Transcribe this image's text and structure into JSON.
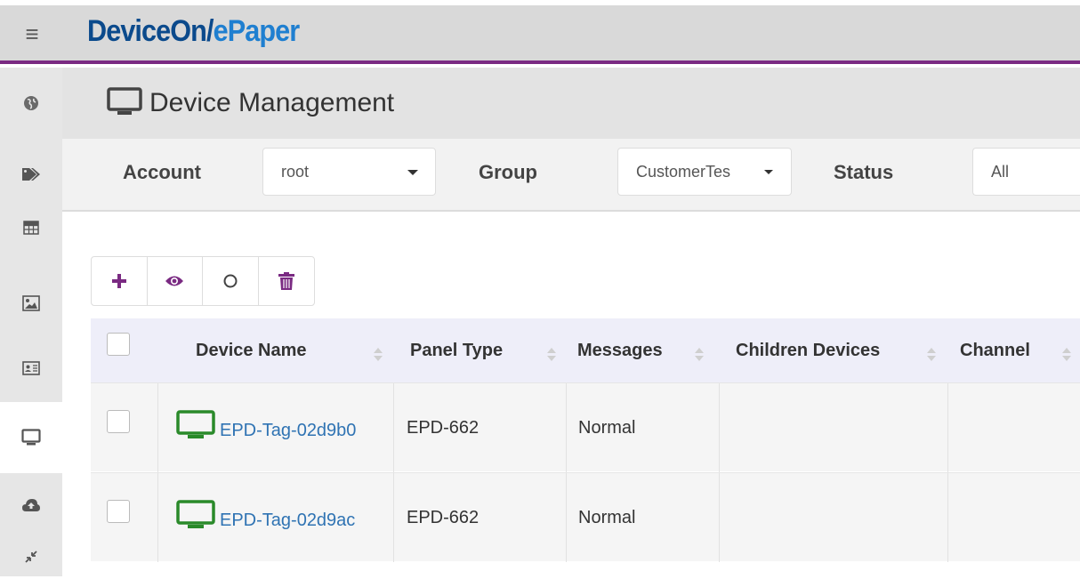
{
  "app": {
    "logo_part1": "DeviceOn/",
    "logo_part2": "ePaper",
    "brand_color": "#0b4a8c",
    "accent_color": "#7a2a82"
  },
  "sidebar": {
    "items": [
      {
        "icon": "globe-icon"
      },
      {
        "icon": "tags-icon"
      },
      {
        "icon": "table-icon"
      },
      {
        "icon": "image-icon"
      },
      {
        "icon": "id-card-icon"
      },
      {
        "icon": "monitor-icon",
        "active": true
      },
      {
        "icon": "cloud-upload-icon"
      },
      {
        "icon": "compress-icon"
      }
    ]
  },
  "page": {
    "title": "Device Management",
    "title_icon": "monitor-icon"
  },
  "filters": {
    "account_label": "Account",
    "account_value": "root",
    "group_label": "Group",
    "group_value": "CustomerTes",
    "status_label": "Status",
    "status_value": "All"
  },
  "toolbar": {
    "add_icon": "plus-icon",
    "view_icon": "eye-icon",
    "status_icon": "circle-icon",
    "delete_icon": "trash-icon",
    "add_color": "#7a2a82"
  },
  "table": {
    "columns": [
      "Device Name",
      "Panel Type",
      "Messages",
      "Children Devices",
      "Channel"
    ],
    "rows": [
      {
        "name": "EPD-Tag-02d9b0",
        "panel_type": "EPD-662",
        "messages": "Normal",
        "children": "",
        "channel": ""
      },
      {
        "name": "EPD-Tag-02d9ac",
        "panel_type": "EPD-662",
        "messages": "Normal",
        "children": "",
        "channel": ""
      }
    ],
    "device_icon_color": "#2a8a2a",
    "link_color": "#2f73b3"
  }
}
